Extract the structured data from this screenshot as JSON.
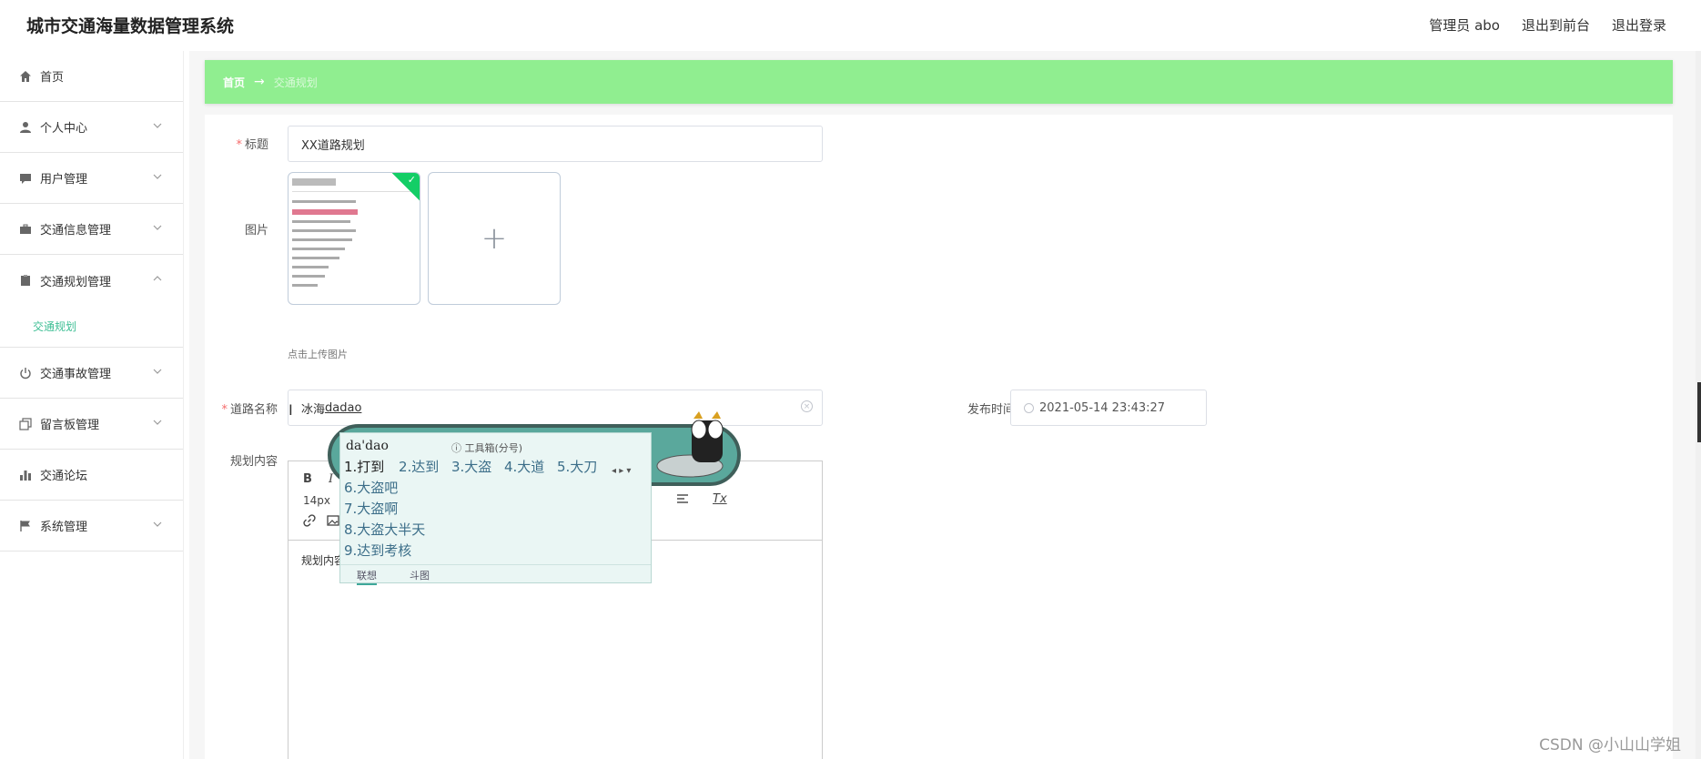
{
  "header": {
    "title": "城市交通海量数据管理系统",
    "user": "管理员 abo",
    "to_front": "退出到前台",
    "logout": "退出登录"
  },
  "sidebar": {
    "items": [
      {
        "label": "首页",
        "icon": "home-icon"
      },
      {
        "label": "个人中心",
        "icon": "user-icon"
      },
      {
        "label": "用户管理",
        "icon": "chat-icon"
      },
      {
        "label": "交通信息管理",
        "icon": "briefcase-icon"
      },
      {
        "label": "交通规划管理",
        "icon": "clipboard-icon"
      },
      {
        "label": "交通事故管理",
        "icon": "power-icon"
      },
      {
        "label": "留言板管理",
        "icon": "copy-icon"
      },
      {
        "label": "交通论坛",
        "icon": "bar-chart-icon"
      },
      {
        "label": "系统管理",
        "icon": "flag-icon"
      }
    ],
    "sub_item": "交通规划"
  },
  "breadcrumb": {
    "home": "首页",
    "separator": "→",
    "current": "交通规划"
  },
  "form": {
    "title_label": "标题",
    "title_value": "XX道路规划",
    "image_label": "图片",
    "upload_hint": "点击上传图片",
    "road_label": "道路名称",
    "road_value_plain": "冰海",
    "road_value_composing": "dadao",
    "publish_label": "发布时间",
    "publish_value": "2021-05-14 23:43:27",
    "content_label": "规划内容",
    "content_placeholder": "规划内容",
    "font_size": "14px",
    "bold_btn": "B",
    "italic_btn": "I",
    "clear_btn": "Tx"
  },
  "ime": {
    "pinyin": "da'dao",
    "toolbox": "工具箱(分号)",
    "candidates": [
      "1.打到",
      "2.达到",
      "3.大盗",
      "4.大道",
      "5.大刀",
      "6.大盗吧",
      "7.大盗啊",
      "8.大盗大半天",
      "9.达到考核"
    ],
    "tabs": [
      "联想",
      "斗图"
    ]
  },
  "watermark": "CSDN @小山山学姐"
}
